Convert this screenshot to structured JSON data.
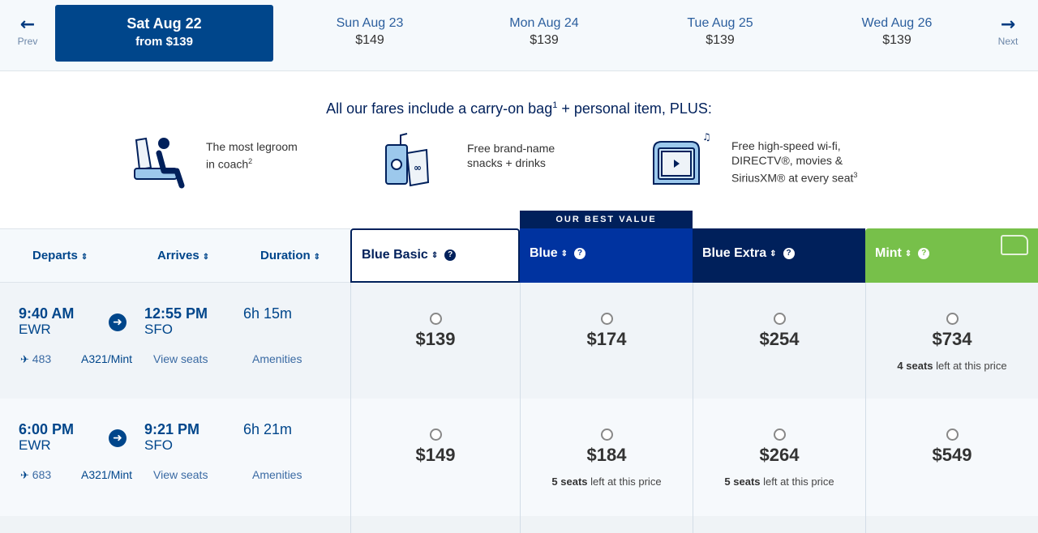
{
  "date_bar": {
    "prev_label": "Prev",
    "next_label": "Next",
    "selected": {
      "day": "Sat Aug 22",
      "price": "from $139"
    },
    "options": [
      {
        "day": "Sun Aug 23",
        "price": "$149"
      },
      {
        "day": "Mon Aug 24",
        "price": "$139"
      },
      {
        "day": "Tue Aug 25",
        "price": "$139"
      },
      {
        "day": "Wed Aug 26",
        "price": "$139"
      }
    ]
  },
  "promo": {
    "title_pre": "All our fares include a carry-on bag",
    "title_sup": "1",
    "title_post": " + personal item, PLUS:",
    "perks": [
      {
        "icon": "seat-legroom-icon",
        "line1": "The most legroom",
        "line2": "in coach",
        "sup": "2"
      },
      {
        "icon": "snacks-drinks-icon",
        "line1": "Free brand-name",
        "line2": "snacks + drinks",
        "sup": ""
      },
      {
        "icon": "seatback-tv-icon",
        "line1": "Free high-speed wi-fi,",
        "line2": "DIRECTV®, movies &",
        "line3": "SiriusXM® at every seat",
        "sup": "3"
      }
    ]
  },
  "table": {
    "columns": {
      "departs": "Departs",
      "arrives": "Arrives",
      "duration": "Duration"
    },
    "best_value_label": "OUR BEST VALUE",
    "fares": [
      {
        "name": "Blue Basic",
        "color": "#ffffff"
      },
      {
        "name": "Blue",
        "color": "#0033a0"
      },
      {
        "name": "Blue Extra",
        "color": "#00205b"
      },
      {
        "name": "Mint",
        "color": "#77c04a"
      }
    ],
    "rows": [
      {
        "dep_time": "9:40 AM",
        "dep_airport": "EWR",
        "arr_time": "12:55 PM",
        "arr_airport": "SFO",
        "duration": "6h 15m",
        "flight_no": "483",
        "aircraft": "A321/Mint",
        "view_seats": "View seats",
        "amenities": "Amenities",
        "prices": [
          {
            "price": "$139",
            "seats_bold": "",
            "seats_rest": ""
          },
          {
            "price": "$174",
            "seats_bold": "",
            "seats_rest": ""
          },
          {
            "price": "$254",
            "seats_bold": "",
            "seats_rest": ""
          },
          {
            "price": "$734",
            "seats_bold": "4 seats",
            "seats_rest": " left at this price"
          }
        ]
      },
      {
        "dep_time": "6:00 PM",
        "dep_airport": "EWR",
        "arr_time": "9:21 PM",
        "arr_airport": "SFO",
        "duration": "6h 21m",
        "flight_no": "683",
        "aircraft": "A321/Mint",
        "view_seats": "View seats",
        "amenities": "Amenities",
        "prices": [
          {
            "price": "$149",
            "seats_bold": "",
            "seats_rest": ""
          },
          {
            "price": "$184",
            "seats_bold": "5 seats",
            "seats_rest": " left at this price"
          },
          {
            "price": "$264",
            "seats_bold": "5 seats",
            "seats_rest": " left at this price"
          },
          {
            "price": "$549",
            "seats_bold": "",
            "seats_rest": ""
          }
        ]
      }
    ]
  }
}
